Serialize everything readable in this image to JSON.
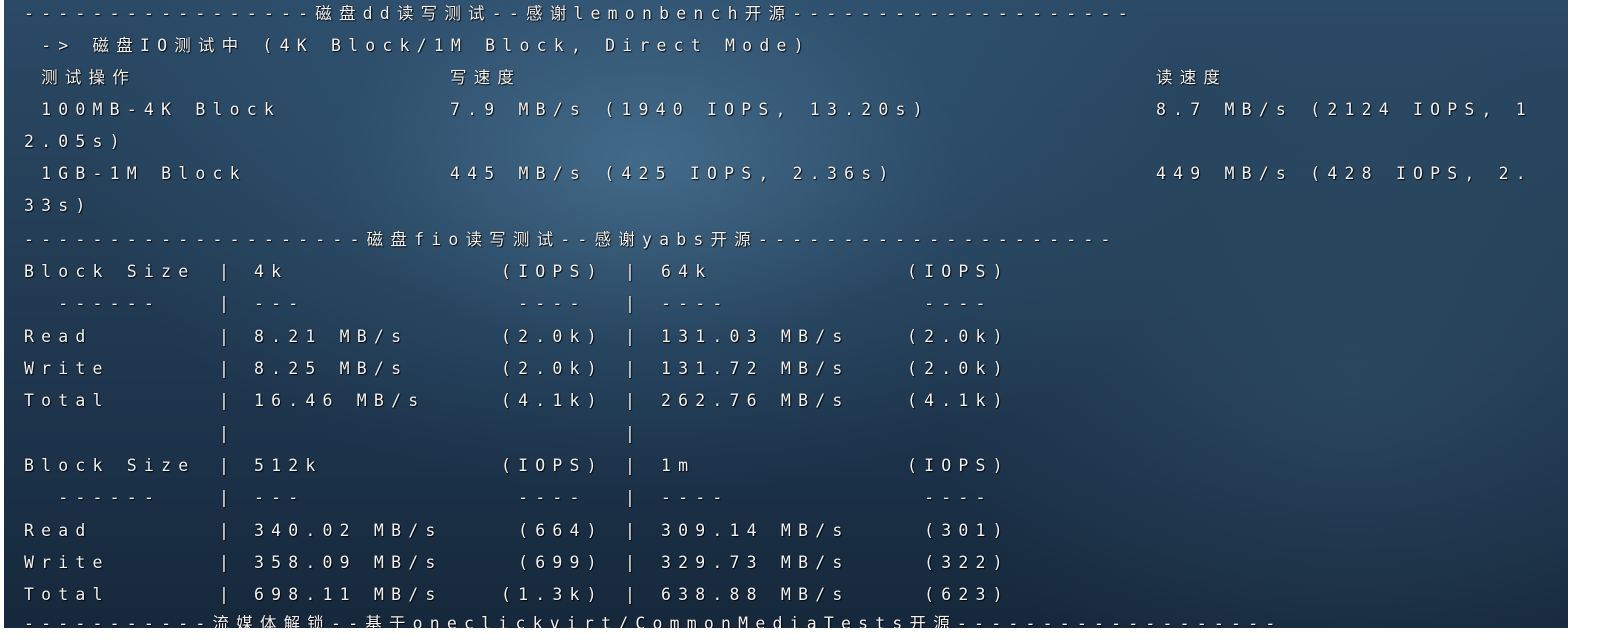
{
  "dd_section": {
    "header": "-----------------磁盘dd读写测试--感谢lemonbench开源--------------------",
    "subtitle": " -> 磁盘IO测试中 (4K Block/1M Block, Direct Mode)",
    "columns": {
      "op": " 测试操作",
      "write": "写速度",
      "read": "读速度"
    },
    "rows": [
      {
        "op": " 100MB-4K Block",
        "write": "7.9 MB/s (1940 IOPS, 13.20s)",
        "read": "8.7 MB/s (2124 IOPS, 1",
        "wrap": "2.05s)"
      },
      {
        "op": " 1GB-1M Block",
        "write": "445 MB/s (425 IOPS, 2.36s)",
        "read": "449 MB/s (428 IOPS, 2.",
        "wrap": "33s)"
      }
    ]
  },
  "fio_section": {
    "header": "--------------------磁盘fio读写测试--感谢yabs开源---------------------",
    "table1": [
      {
        "label": "Block Size",
        "v1": "4k",
        "i1": "(IOPS)",
        "v2": "64k",
        "i2": "(IOPS)"
      },
      {
        "label": "  ------",
        "v1": "---",
        "i1": " ----",
        "v2": "----",
        "i2": " ----"
      },
      {
        "label": "Read",
        "v1": "8.21 MB/s",
        "i1": "(2.0k)",
        "v2": "131.03 MB/s",
        "i2": "(2.0k)"
      },
      {
        "label": "Write",
        "v1": "8.25 MB/s",
        "i1": "(2.0k)",
        "v2": "131.72 MB/s",
        "i2": "(2.0k)"
      },
      {
        "label": "Total",
        "v1": "16.46 MB/s",
        "i1": "(4.1k)",
        "v2": "262.76 MB/s",
        "i2": "(4.1k)"
      }
    ],
    "table2": [
      {
        "label": "Block Size",
        "v1": "512k",
        "i1": "(IOPS)",
        "v2": "1m",
        "i2": "(IOPS)"
      },
      {
        "label": "  ------",
        "v1": "---",
        "i1": " ----",
        "v2": "----",
        "i2": " ----"
      },
      {
        "label": "Read",
        "v1": "340.02 MB/s",
        "i1": " (664)",
        "v2": "309.14 MB/s",
        "i2": " (301)"
      },
      {
        "label": "Write",
        "v1": "358.09 MB/s",
        "i1": " (699)",
        "v2": "329.73 MB/s",
        "i2": " (322)"
      },
      {
        "label": "Total",
        "v1": "698.11 MB/s",
        "i1": "(1.3k)",
        "v2": "638.88 MB/s",
        "i2": " (623)"
      }
    ],
    "separator": "|"
  },
  "next_header": "-----------流媒体解锁--基于oneclickvirt/CommonMediaTests开源-------------------"
}
